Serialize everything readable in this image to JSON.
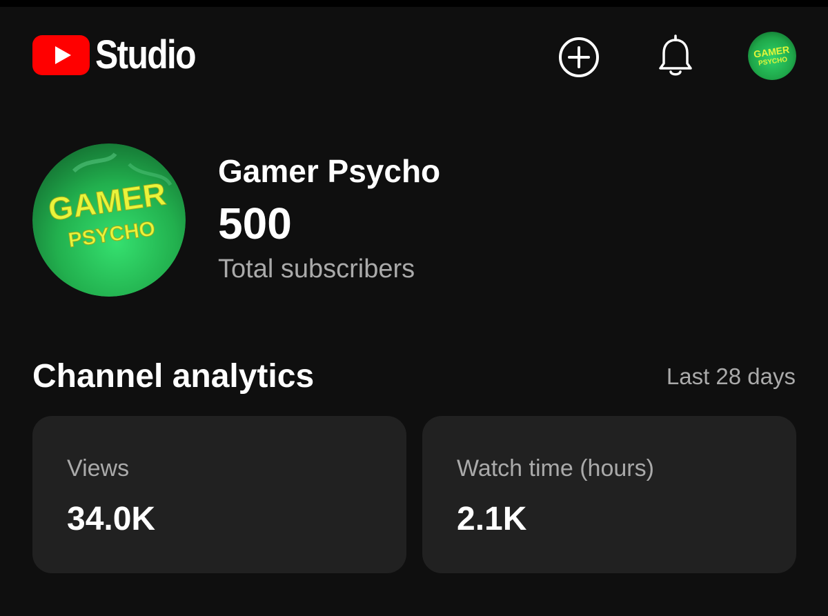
{
  "header": {
    "logo_text": "Studio",
    "icons": {
      "logo": "youtube-play-icon",
      "create": "add-circle-icon",
      "notifications": "bell-icon",
      "account": "channel-avatar"
    },
    "colors": {
      "brand_red": "#ff0000",
      "background": "#0f0f0f",
      "card": "#212121"
    }
  },
  "channel": {
    "name": "Gamer Psycho",
    "subscriber_count": "500",
    "subscriber_label": "Total subscribers",
    "avatar_text": [
      "GAMER",
      "PSYCHO"
    ]
  },
  "analytics": {
    "title": "Channel analytics",
    "range": "Last 28 days",
    "cards": [
      {
        "label": "Views",
        "value": "34.0K"
      },
      {
        "label": "Watch time (hours)",
        "value": "2.1K"
      }
    ]
  }
}
